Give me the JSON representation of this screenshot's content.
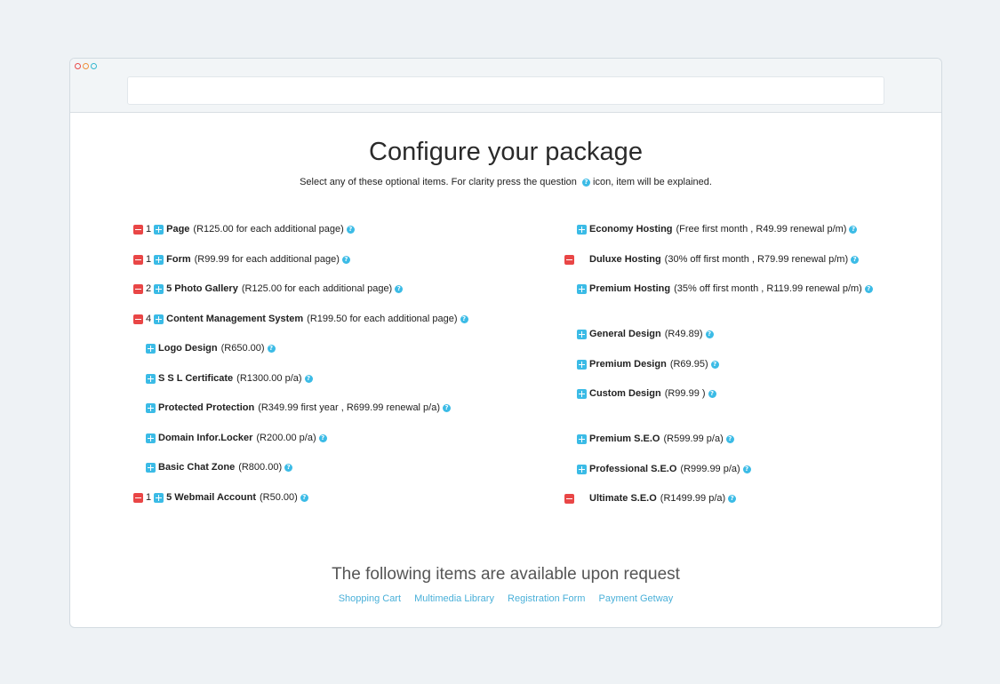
{
  "window": {
    "controls": [
      "close",
      "minimize",
      "maximize"
    ],
    "address_bar": ""
  },
  "header": {
    "title": "Configure your package",
    "subtitle_pre": "Select any of these optional items. For clarity press the question",
    "subtitle_post": "icon, item will be explained."
  },
  "help_icon": "?",
  "left_items": [
    {
      "qty": "1",
      "name": "Page",
      "desc": "(R125.00 for each additional page)"
    },
    {
      "qty": "1",
      "name": "Form",
      "desc": "(R99.99 for each additional page)"
    },
    {
      "qty": "2",
      "name": "5 Photo Gallery",
      "desc": "(R125.00 for each additional page)"
    },
    {
      "qty": "4",
      "name": "Content Management System",
      "desc": "(R199.50 for each additional page)"
    },
    {
      "name": "Logo Design",
      "desc": "(R650.00)"
    },
    {
      "name": "S S L Certificate",
      "desc": "(R1300.00 p/a)"
    },
    {
      "name": "Protected Protection",
      "desc": "(R349.99 first year , R699.99 renewal p/a)"
    },
    {
      "name": "Domain Infor.Locker",
      "desc": "(R200.00 p/a)"
    },
    {
      "name": "Basic Chat Zone",
      "desc": "(R800.00)"
    },
    {
      "qty": "1",
      "name": "5 Webmail Account",
      "desc": "(R50.00)"
    }
  ],
  "right_items": [
    {
      "name": "Economy Hosting",
      "desc": "(Free first month , R49.99 renewal p/m)"
    },
    {
      "name": "Duluxe Hosting",
      "desc": "(30% off first month , R79.99 renewal p/m)"
    },
    {
      "name": "Premium Hosting",
      "desc": "(35% off first month , R119.99 renewal p/m)"
    },
    {
      "name": "General Design",
      "desc": "(R49.89)"
    },
    {
      "name": "Premium Design",
      "desc": "(R69.95)"
    },
    {
      "name": "Custom Design",
      "desc": "(R99.99 )"
    },
    {
      "name": "Premium S.E.O",
      "desc": "(R599.99 p/a)"
    },
    {
      "name": "Professional S.E.O",
      "desc": "(R999.99 p/a)"
    },
    {
      "name": "Ultimate S.E.O",
      "desc": "(R1499.99 p/a)"
    }
  ],
  "footer": {
    "title": "The following items are available upon request",
    "links": [
      "Shopping Cart",
      "Multimedia Library",
      "Registration Form",
      "Payment Getway"
    ]
  },
  "colors": {
    "minus": "#e94646",
    "plus": "#3bbbe6",
    "link": "#4ab0d9"
  }
}
